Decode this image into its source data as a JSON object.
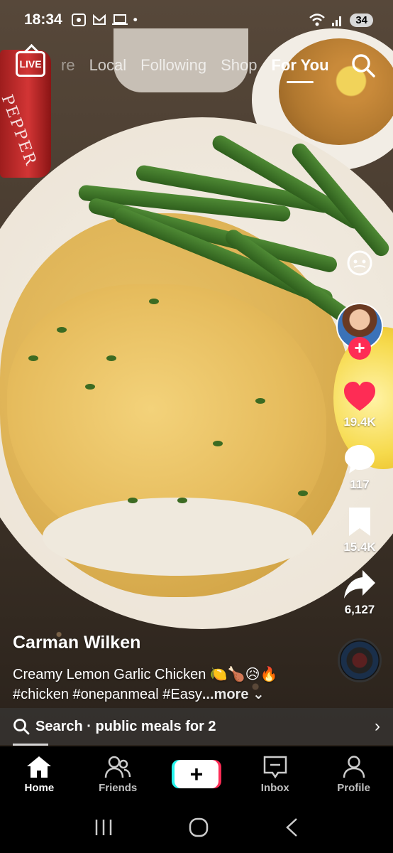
{
  "status_bar": {
    "time": "18:34",
    "battery": "34",
    "dot": "•"
  },
  "top_nav": {
    "live_label": "LIVE",
    "tabs": [
      {
        "label": "re"
      },
      {
        "label": "Local"
      },
      {
        "label": "Following"
      },
      {
        "label": "Shop"
      },
      {
        "label": "For You"
      }
    ],
    "active_tab": "For You"
  },
  "pepper_text": "PEPPER",
  "actions": {
    "likes": "19.4K",
    "comments": "117",
    "saves": "15.4K",
    "shares": "6,127",
    "follow_symbol": "+"
  },
  "caption": {
    "author": "Carman Wilken",
    "title": "Creamy Lemon Garlic Chicken 🍋🍗😥🔥",
    "tags": "#chicken #onepanmeal #Easy",
    "more": "...more ⌄"
  },
  "search_strip": {
    "label": "Search · public meals for 2",
    "chevron": "›"
  },
  "bottom_nav": {
    "items": [
      {
        "label": "Home"
      },
      {
        "label": "Friends"
      },
      {
        "label": "+"
      },
      {
        "label": "Inbox"
      },
      {
        "label": "Profile"
      }
    ]
  },
  "colors": {
    "accent_red": "#fe2c55",
    "accent_cyan": "#25f4ee"
  }
}
